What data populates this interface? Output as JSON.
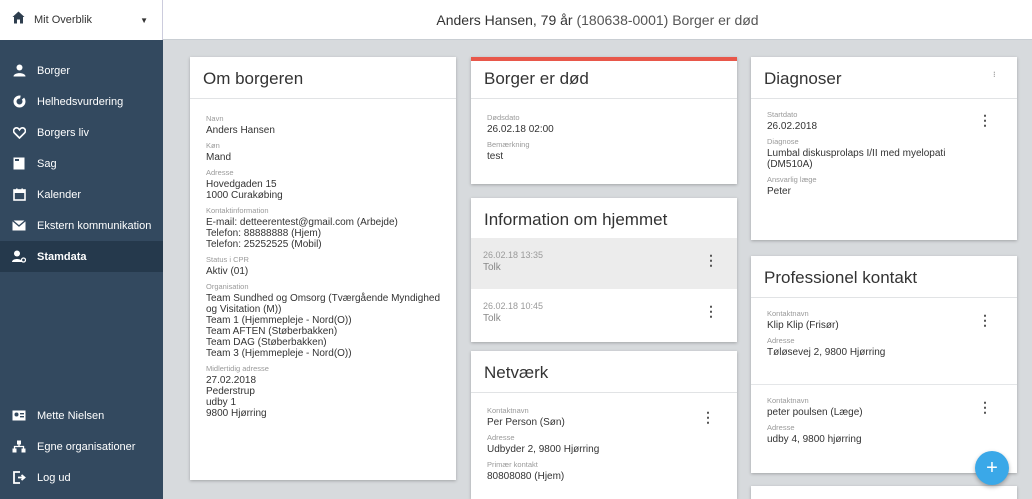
{
  "topnav": {
    "dropdown_label": "Mit Overblik"
  },
  "header": {
    "title": "Anders Hansen, 79 år",
    "subtitle": "(180638-0001) Borger er død"
  },
  "sidebar": {
    "items": [
      {
        "label": "Borger"
      },
      {
        "label": "Helhedsvurdering"
      },
      {
        "label": "Borgers liv"
      },
      {
        "label": "Sag"
      },
      {
        "label": "Kalender"
      },
      {
        "label": "Ekstern kommunikation"
      },
      {
        "label": "Stamdata"
      }
    ],
    "bottom": [
      {
        "label": "Mette Nielsen"
      },
      {
        "label": "Egne organisationer"
      },
      {
        "label": "Log ud"
      }
    ]
  },
  "om_borgeren": {
    "title": "Om borgeren",
    "navn_label": "Navn",
    "navn": "Anders Hansen",
    "koen_label": "Køn",
    "koen": "Mand",
    "adresse_label": "Adresse",
    "adresse1": "Hovedgaden 15",
    "adresse2": "1000 Curakøbing",
    "kontakt_label": "Kontaktinformation",
    "kontakt1": "E-mail: detteerentest@gmail.com (Arbejde)",
    "kontakt2": "Telefon: 88888888 (Hjem)",
    "kontakt3": "Telefon: 25252525 (Mobil)",
    "cpr_label": "Status i CPR",
    "cpr": "Aktiv (01)",
    "org_label": "Organisation",
    "org1": "Team Sundhed og Omsorg (Tværgående Myndighed",
    "org2": "og Visitation (M))",
    "org3": "Team 1 (Hjemmepleje - Nord(O))",
    "org4": "Team AFTEN (Støberbakken)",
    "org5": "Team DAG (Støberbakken)",
    "org6": "Team 3 (Hjemmepleje - Nord(O))",
    "midl_label": "Midlertidig adresse",
    "midl1": "27.02.2018",
    "midl2": "Pederstrup",
    "midl3": "udby 1",
    "midl4": "9800 Hjørring"
  },
  "doed": {
    "title": "Borger er død",
    "accent": "#e8574a",
    "dato_label": "Dødsdato",
    "dato": "26.02.18 02:00",
    "bem_label": "Bemærkning",
    "bem": "test"
  },
  "hjem": {
    "title": "Information om hjemmet",
    "rows": [
      {
        "date": "26.02.18 13:35",
        "text": "Tolk"
      },
      {
        "date": "26.02.18 10:45",
        "text": "Tolk"
      }
    ]
  },
  "netvaerk": {
    "title": "Netværk",
    "navn_label": "Kontaktnavn",
    "navn": "Per Person (Søn)",
    "adr_label": "Adresse",
    "adr": "Udbyder 2, 9800 Hjørring",
    "prim_label": "Primær kontakt",
    "prim": "80808080 (Hjem)"
  },
  "diagnoser": {
    "title": "Diagnoser",
    "start_label": "Startdato",
    "start": "26.02.2018",
    "diag_label": "Diagnose",
    "diag1": "Lumbal diskusprolaps I/II med myelopati",
    "diag2": "(DM510A)",
    "laege_label": "Ansvarlig læge",
    "laege": "Peter"
  },
  "prof": {
    "title": "Professionel kontakt",
    "c1_navn_label": "Kontaktnavn",
    "c1_navn": "Klip Klip (Frisør)",
    "c1_adr_label": "Adresse",
    "c1_adr": "Tøløsevej 2, 9800 Hjørring",
    "c2_navn_label": "Kontaktnavn",
    "c2_navn": "peter poulsen (Læge)",
    "c2_adr_label": "Adresse",
    "c2_adr": "udby 4, 9800 hjørring"
  },
  "fab": {
    "label": "+"
  }
}
